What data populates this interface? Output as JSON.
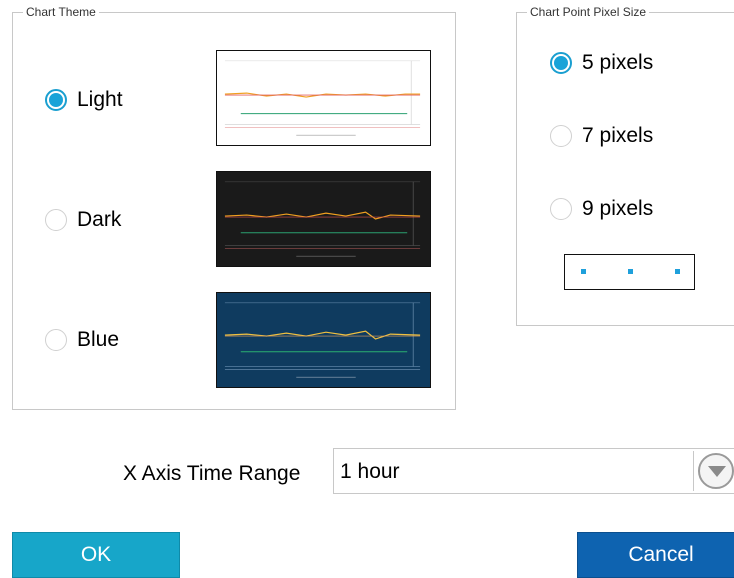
{
  "chart_theme": {
    "legend": "Chart Theme",
    "options": [
      {
        "label": "Light",
        "checked": true,
        "preview_bg": "#ffffff"
      },
      {
        "label": "Dark",
        "checked": false,
        "preview_bg": "#1a1a1a"
      },
      {
        "label": "Blue",
        "checked": false,
        "preview_bg": "#0f3b5f"
      }
    ]
  },
  "point_size": {
    "legend": "Chart Point Pixel Size",
    "options": [
      {
        "label": "5 pixels",
        "checked": true
      },
      {
        "label": "7 pixels",
        "checked": false
      },
      {
        "label": "9 pixels",
        "checked": false
      }
    ],
    "dot_color": "#1fa0db"
  },
  "time_range": {
    "label": "X Axis Time Range",
    "value": "1 hour"
  },
  "buttons": {
    "ok": "OK",
    "cancel": "Cancel"
  },
  "colors": {
    "accent": "#19a3d8",
    "ok_bg": "#17a6c9",
    "cancel_bg": "#0e63b0",
    "series_orange": "#f0a020",
    "series_green": "#2aa070"
  }
}
